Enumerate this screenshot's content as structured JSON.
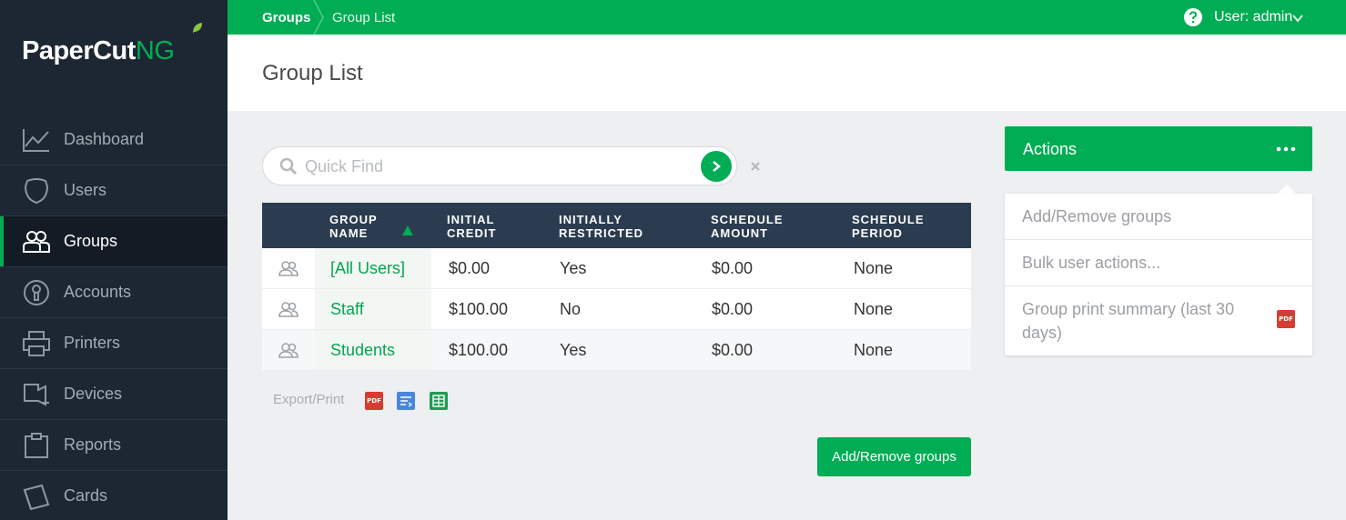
{
  "logo": {
    "main": "PaperCut",
    "suffix": "NG"
  },
  "nav": [
    {
      "label": "Dashboard",
      "icon": "chart-line-icon",
      "active": false
    },
    {
      "label": "Users",
      "icon": "user-icon",
      "active": false
    },
    {
      "label": "Groups",
      "icon": "group-icon",
      "active": true
    },
    {
      "label": "Accounts",
      "icon": "account-icon",
      "active": false
    },
    {
      "label": "Printers",
      "icon": "printer-icon",
      "active": false
    },
    {
      "label": "Devices",
      "icon": "device-icon",
      "active": false
    },
    {
      "label": "Reports",
      "icon": "clipboard-icon",
      "active": false
    },
    {
      "label": "Cards",
      "icon": "cards-icon",
      "active": false
    }
  ],
  "topbar": {
    "breadcrumb": [
      "Groups",
      "Group List"
    ],
    "user_label": "User: admin"
  },
  "page": {
    "title": "Group List"
  },
  "search": {
    "placeholder": "Quick Find"
  },
  "table": {
    "headers": [
      {
        "line1": "GROUP",
        "line2": "NAME"
      },
      {
        "line1": "INITIAL",
        "line2": "CREDIT"
      },
      {
        "line1": "INITIALLY",
        "line2": "RESTRICTED"
      },
      {
        "line1": "SCHEDULE",
        "line2": "AMOUNT"
      },
      {
        "line1": "SCHEDULE",
        "line2": "PERIOD"
      }
    ],
    "rows": [
      {
        "name": "[All Users]",
        "credit": "$0.00",
        "restricted": "Yes",
        "amount": "$0.00",
        "period": "None"
      },
      {
        "name": "Staff",
        "credit": "$100.00",
        "restricted": "No",
        "amount": "$0.00",
        "period": "None"
      },
      {
        "name": "Students",
        "credit": "$100.00",
        "restricted": "Yes",
        "amount": "$0.00",
        "period": "None"
      }
    ]
  },
  "export": {
    "label": "Export/Print",
    "pdf_text": "PDF"
  },
  "add_button": "Add/Remove groups",
  "actions": {
    "title": "Actions",
    "items": [
      {
        "label": "Add/Remove groups"
      },
      {
        "label": "Bulk user actions..."
      },
      {
        "label": "Group print summary (last 30 days)",
        "badge": "PDF"
      }
    ]
  },
  "colors": {
    "brand_green": "#00ad54",
    "sidebar_bg": "#1c2733",
    "table_header": "#2b3c50",
    "pdf_red": "#d63d32"
  }
}
